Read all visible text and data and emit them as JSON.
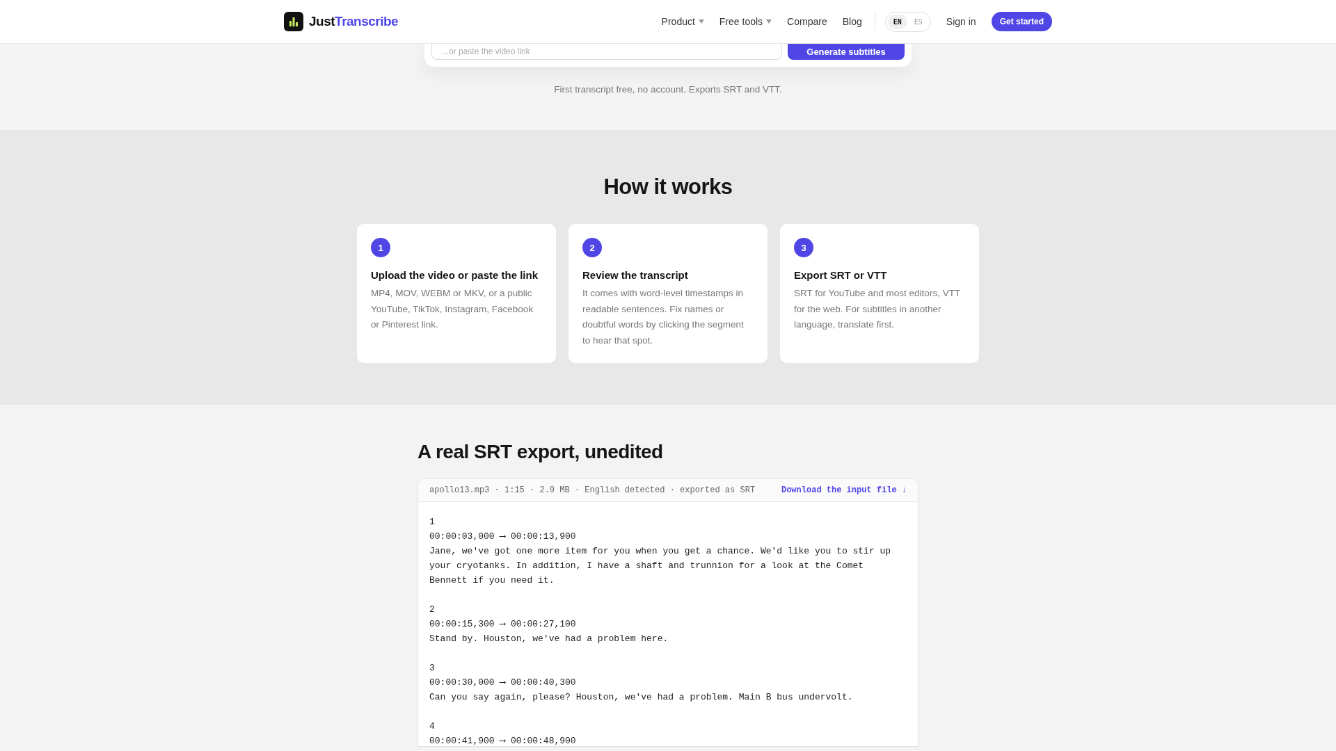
{
  "header": {
    "logo": {
      "part_1": "Just",
      "part_2": "Transcribe"
    },
    "nav": [
      {
        "label": "Product",
        "dropdown": true
      },
      {
        "label": "Free tools",
        "dropdown": true
      },
      {
        "label": "Compare",
        "dropdown": false
      },
      {
        "label": "Blog",
        "dropdown": false
      }
    ],
    "languages": [
      {
        "label": "EN",
        "selected": true
      },
      {
        "label": "ES",
        "selected": false
      }
    ],
    "sign_in": "Sign in",
    "cta": "Get started"
  },
  "hero": {
    "link_field": {
      "placeholder": "...or paste the video link"
    },
    "submit": "Generate subtitles",
    "note": "First transcript free, no account. Exports SRT and VTT."
  },
  "how_it_works": {
    "title": "How it works",
    "steps": [
      {
        "number": "1",
        "title": "Upload the video or paste the link",
        "text": "MP4, MOV, WEBM or MKV, or a public YouTube, TikTok, Instagram, Facebook or Pinterest link."
      },
      {
        "number": "2",
        "title": "Review the transcript",
        "text": "It comes with word-level timestamps in readable sentences. Fix names or doubtful words by clicking the segment to hear that spot."
      },
      {
        "number": "3",
        "title": "Export SRT or VTT",
        "text": "SRT for YouTube and most editors, VTT for the web. For subtitles in another language, translate first."
      }
    ]
  },
  "example": {
    "title": "A real SRT export, unedited",
    "file_info": "apollo13.mp3 · 1:15 · 2.9 MB · English detected · exported as SRT",
    "download_link": "Download the input file ↓",
    "cues": [
      {
        "index": "1",
        "timing": "00:00:03,000 ⟶ 00:00:13,900",
        "text": "Jane, we've got one more item for you when you get a chance. We'd like you to stir up your cryotanks. In addition, I have a shaft and trunnion for a look at the Comet Bennett if you need it."
      },
      {
        "index": "2",
        "timing": "00:00:15,300 ⟶ 00:00:27,100",
        "text": "Stand by. Houston, we've had a problem here."
      },
      {
        "index": "3",
        "timing": "00:00:30,000 ⟶ 00:00:40,300",
        "text": "Can you say again, please? Houston, we've had a problem. Main B bus undervolt."
      },
      {
        "index": "4",
        "timing": "00:00:41,900 ⟶ 00:00:48,900"
      }
    ]
  }
}
